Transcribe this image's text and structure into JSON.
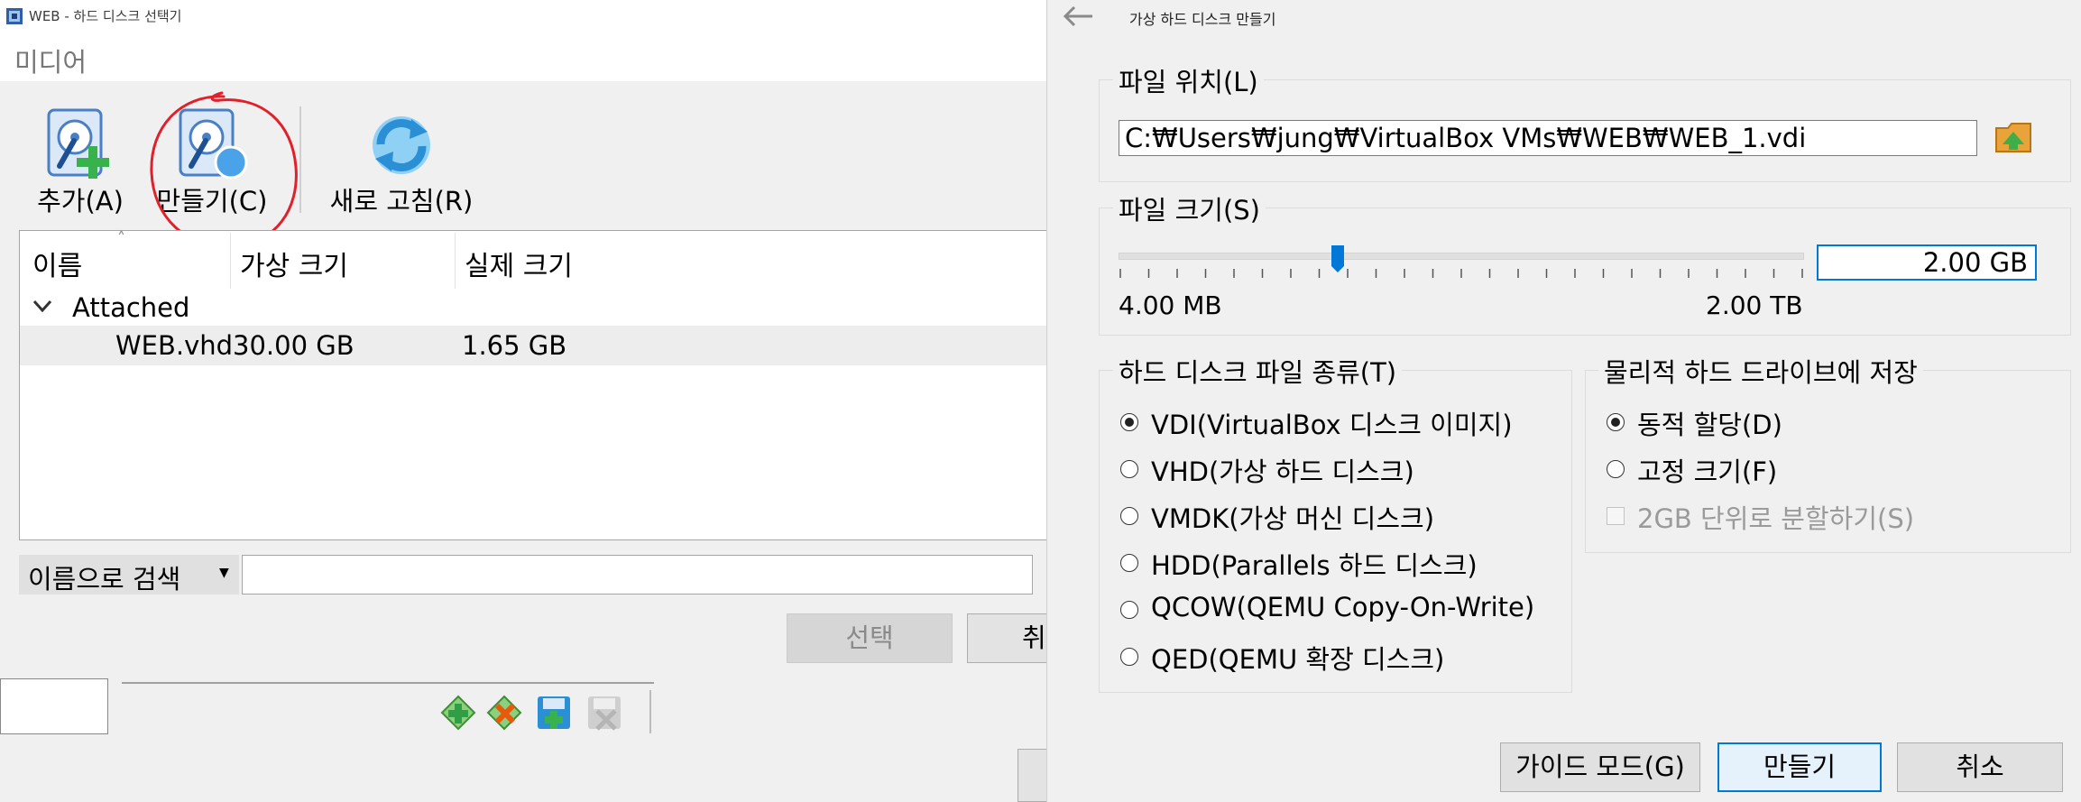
{
  "left_dialog": {
    "title": "WEB - 하드 디스크 선택기",
    "subtitle": "미디어",
    "toolbar": {
      "add_label": "추가(A)",
      "create_label": "만들기(C)",
      "refresh_label": "새로 고침(R)"
    },
    "table": {
      "columns": [
        "이름",
        "가상 크기",
        "실제 크기"
      ],
      "group_label": "Attached",
      "rows": [
        {
          "name": "WEB.vhd",
          "virtual_size": "30.00 GB",
          "actual_size": "1.65 GB"
        }
      ]
    },
    "search": {
      "combo_label": "이름으로 검색",
      "value": ""
    },
    "select_label": "선택",
    "cancel_label": "취"
  },
  "right_panel": {
    "title": "가상 하드 디스크 만들기",
    "file_location": {
      "group_title": "파일 위치(L)",
      "path": "C:₩Users₩jung₩VirtualBox VMs₩WEB₩WEB_1.vdi"
    },
    "file_size": {
      "group_title": "파일 크기(S)",
      "min_label": "4.00 MB",
      "max_label": "2.00 TB",
      "value": "2.00 GB",
      "slider_fraction": 0.32
    },
    "disk_type": {
      "group_title": "하드 디스크 파일 종류(T)",
      "options": [
        {
          "label": "VDI(VirtualBox 디스크 이미지)",
          "selected": true
        },
        {
          "label": "VHD(가상 하드 디스크)",
          "selected": false
        },
        {
          "label": "VMDK(가상 머신 디스크)",
          "selected": false
        },
        {
          "label": "HDD(Parallels 하드 디스크)",
          "selected": false
        },
        {
          "label": "QCOW(QEMU Copy-On-Write)",
          "selected": false
        },
        {
          "label": "QED(QEMU 확장 디스크)",
          "selected": false
        }
      ]
    },
    "storage": {
      "group_title": "물리적 하드 드라이브에 저장",
      "dynamic_label": "동적 할당(D)",
      "dynamic_selected": true,
      "fixed_label": "고정 크기(F)",
      "fixed_selected": false,
      "split_label": "2GB 단위로 분할하기(S)",
      "split_checked": false
    },
    "buttons": {
      "guided_label": "가이드 모드(G)",
      "create_label": "만들기",
      "cancel_label": "취소"
    }
  },
  "colors": {
    "accent": "#0078d7",
    "annotation": "#e0202a"
  }
}
